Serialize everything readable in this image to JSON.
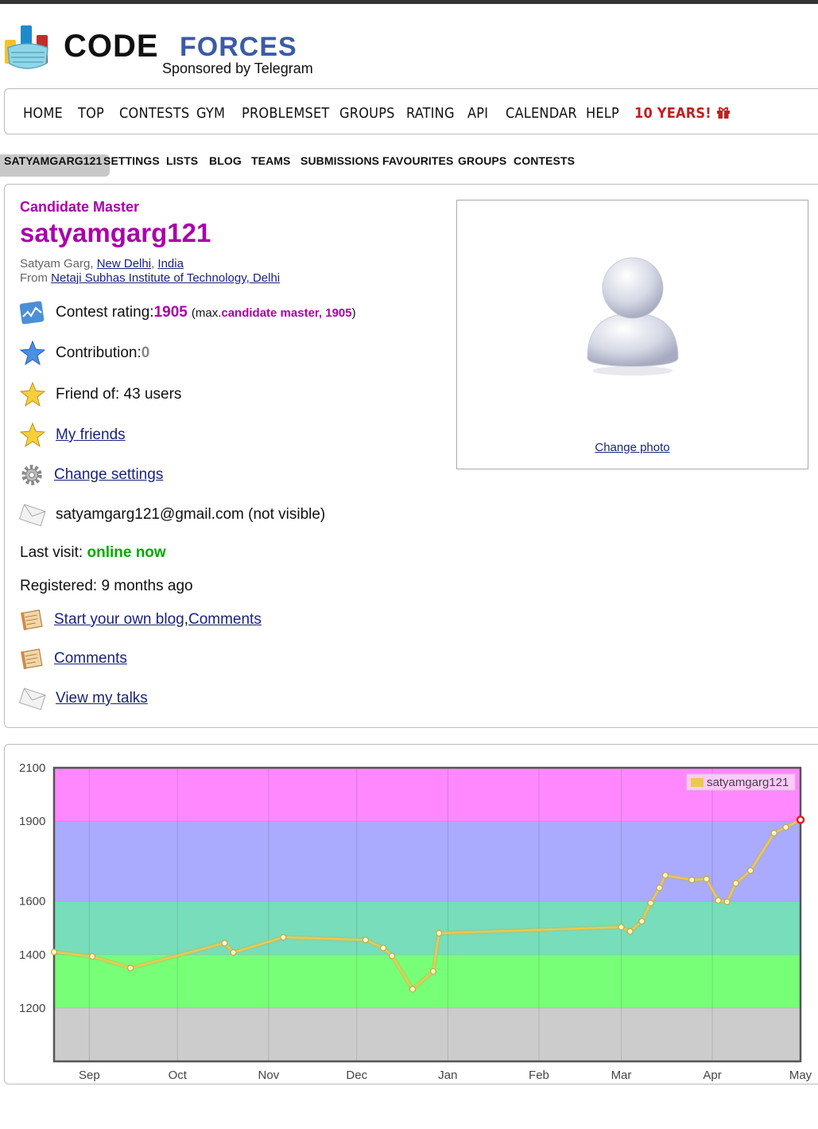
{
  "logo": {
    "code": "CODE",
    "forces": "FORCES",
    "sponsor": "Sponsored by Telegram"
  },
  "main_menu": [
    "HOME",
    "TOP",
    "CONTESTS",
    "GYM",
    "PROBLEMSET",
    "GROUPS",
    "RATING",
    "API",
    "CALENDAR",
    "HELP",
    "10 YEARS!"
  ],
  "second_menu": [
    "SATYAMGARG121",
    "SETTINGS",
    "LISTS",
    "BLOG",
    "TEAMS",
    "SUBMISSIONS",
    "FAVOURITES",
    "GROUPS",
    "CONTESTS"
  ],
  "profile": {
    "rank": "Candidate Master",
    "handle": "satyamgarg121",
    "name_prefix": "Satyam Garg, ",
    "city": "New Delhi",
    "comma": ", ",
    "country": "India",
    "from_prefix": "From ",
    "organization": "Netaji Subhas Institute of Technology, Delhi",
    "rating_label": "Contest rating: ",
    "rating_value": "1905",
    "max_open": "(max. ",
    "max_rank": "candidate master, 1905",
    "max_close": ")",
    "contribution_label": "Contribution: ",
    "contribution_value": "0",
    "friend_of": "Friend of: 43 users",
    "my_friends": "My friends",
    "change_settings": "Change settings",
    "email": "satyamgarg121@gmail.com (not visible)",
    "last_visit_label": "Last visit: ",
    "last_visit_value": "online now",
    "registered": "Registered: 9 months ago",
    "start_blog": "Start your own blog",
    "blog_comma": ", ",
    "comments_inline": "Comments",
    "comments": "Comments",
    "view_talks": "View my talks",
    "change_photo": "Change photo"
  },
  "icons": {
    "rating": "rating-chart-icon",
    "contribution": "blue-star-icon",
    "friend_of": "gold-star-icon",
    "my_friends": "gold-star-icon",
    "settings": "gear-icon",
    "email": "envelope-icon",
    "blog": "notebook-icon",
    "comments": "notebook-icon",
    "talks": "envelope-icon",
    "gift": "gift-icon"
  },
  "colors": {
    "rank_purple": "#aa00aa",
    "online_green": "#00aa00",
    "link_navy": "#1a237e",
    "forces_blue": "#3b5ba5",
    "years_red": "#c02020",
    "line_yellow": "#ecc94b"
  },
  "chart_data": {
    "type": "line",
    "series": [
      {
        "name": "satyamgarg121",
        "points": [
          [
            "2020-08-20",
            1410
          ],
          [
            "2020-09-02",
            1393
          ],
          [
            "2020-09-15",
            1350
          ],
          [
            "2020-10-17",
            1443
          ],
          [
            "2020-10-20",
            1408
          ],
          [
            "2020-11-06",
            1465
          ],
          [
            "2020-12-04",
            1455
          ],
          [
            "2020-12-10",
            1425
          ],
          [
            "2020-12-13",
            1395
          ],
          [
            "2020-12-20",
            1270
          ],
          [
            "2020-12-27",
            1337
          ],
          [
            "2020-12-29",
            1480
          ],
          [
            "2021-03-01",
            1503
          ],
          [
            "2021-03-04",
            1487
          ],
          [
            "2021-03-08",
            1525
          ],
          [
            "2021-03-11",
            1593
          ],
          [
            "2021-03-14",
            1650
          ],
          [
            "2021-03-16",
            1697
          ],
          [
            "2021-03-25",
            1680
          ],
          [
            "2021-03-30",
            1683
          ],
          [
            "2021-04-03",
            1603
          ],
          [
            "2021-04-06",
            1598
          ],
          [
            "2021-04-09",
            1667
          ],
          [
            "2021-04-14",
            1715
          ],
          [
            "2021-04-22",
            1855
          ],
          [
            "2021-04-26",
            1877
          ],
          [
            "2021-05-01",
            1905
          ]
        ]
      }
    ],
    "x_ticks": [
      "Sep",
      "Oct",
      "Nov",
      "Dec",
      "Jan",
      "Feb",
      "Mar",
      "Apr",
      "May"
    ],
    "x_tick_dates": [
      "2020-09-01",
      "2020-10-01",
      "2020-11-01",
      "2020-12-01",
      "2021-01-01",
      "2021-02-01",
      "2021-03-01",
      "2021-04-01",
      "2021-05-01"
    ],
    "y_ticks": [
      1200,
      1400,
      1600,
      1900,
      2100
    ],
    "xlim": [
      "2020-08-20",
      "2021-05-01"
    ],
    "ylim": [
      1000,
      2100
    ],
    "bands": [
      {
        "from": 1000,
        "to": 1200,
        "color": "#cccccc"
      },
      {
        "from": 1200,
        "to": 1400,
        "color": "#77ff77"
      },
      {
        "from": 1400,
        "to": 1600,
        "color": "#77ddbb"
      },
      {
        "from": 1600,
        "to": 1900,
        "color": "#aaaaff"
      },
      {
        "from": 1900,
        "to": 2100,
        "color": "#ff88ff"
      }
    ],
    "grid": true,
    "legend": "top-right"
  }
}
